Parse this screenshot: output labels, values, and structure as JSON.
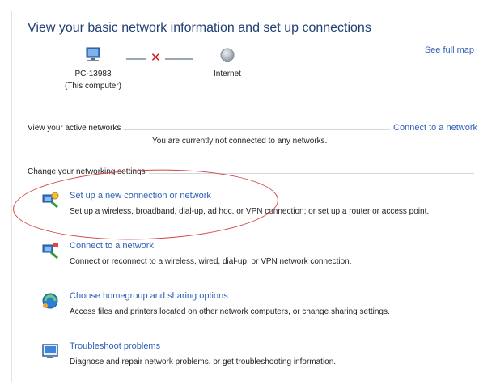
{
  "header": {
    "title": "View your basic network information and set up connections",
    "see_full_map": "See full map"
  },
  "network_map": {
    "computer_name": "PC-13983",
    "computer_sub": "(This computer)",
    "internet_label": "Internet",
    "status_mark": "✕"
  },
  "active_networks": {
    "section_label": "View your active networks",
    "connect_link": "Connect to a network",
    "status_text": "You are currently not connected to any networks."
  },
  "settings": {
    "section_label": "Change your networking settings",
    "tasks": [
      {
        "link": "Set up a new connection or network",
        "description": "Set up a wireless, broadband, dial-up, ad hoc, or VPN connection; or set up a router or access point.",
        "icon": "network-setup-icon"
      },
      {
        "link": "Connect to a network",
        "description": "Connect or reconnect to a wireless, wired, dial-up, or VPN network connection.",
        "icon": "network-connect-icon"
      },
      {
        "link": "Choose homegroup and sharing options",
        "description": "Access files and printers located on other network computers, or change sharing settings.",
        "icon": "homegroup-icon"
      },
      {
        "link": "Troubleshoot problems",
        "description": "Diagnose and repair network problems, or get troubleshooting information.",
        "icon": "troubleshoot-icon"
      }
    ]
  },
  "colors": {
    "link": "#2f62b5",
    "title": "#1f3f74",
    "error_x": "#d21515",
    "annotation": "#d24545"
  }
}
